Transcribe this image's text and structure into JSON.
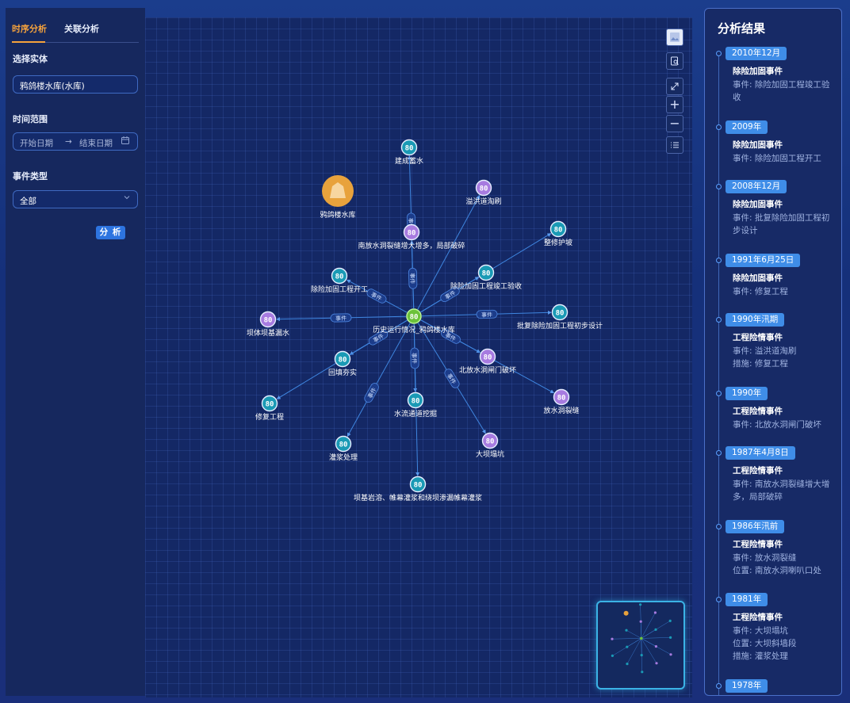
{
  "tabs": [
    {
      "label": "时序分析",
      "active": true
    },
    {
      "label": "关联分析",
      "active": false
    }
  ],
  "form": {
    "entity_label": "选择实体",
    "entity_value": "鸦鸽楼水库(水库)",
    "time_label": "时间范围",
    "start_placeholder": "开始日期",
    "end_placeholder": "结束日期",
    "event_type_label": "事件类型",
    "event_type_value": "全部",
    "analyze_button": "分 析"
  },
  "graph": {
    "edge_label": "事件",
    "center": {
      "label": "历史运行情况_鸦鸽楼水库",
      "icon": "80"
    },
    "reservoir": {
      "label": "鸦鸽楼水库"
    },
    "nodes": [
      {
        "label": "建成蓄水",
        "icon": "80",
        "color": "teal"
      },
      {
        "label": "溢洪道淘刷",
        "icon": "80",
        "color": "purple"
      },
      {
        "label": "南放水洞裂缝增大增多，局部破碎",
        "icon": "80",
        "color": "purple"
      },
      {
        "label": "整修护坡",
        "icon": "80",
        "color": "teal"
      },
      {
        "label": "除险加固工程开工",
        "icon": "80",
        "color": "teal"
      },
      {
        "label": "除险加固工程竣工验收",
        "icon": "80",
        "color": "teal"
      },
      {
        "label": "坝体坝基漏水",
        "icon": "80",
        "color": "purple"
      },
      {
        "label": "批复除险加固工程初步设计",
        "icon": "80",
        "color": "teal"
      },
      {
        "label": "回填夯实",
        "icon": "80",
        "color": "teal"
      },
      {
        "label": "北放水洞闸门破坏",
        "icon": "80",
        "color": "purple"
      },
      {
        "label": "修复工程",
        "icon": "80",
        "color": "teal"
      },
      {
        "label": "水流通道挖掘",
        "icon": "80",
        "color": "teal"
      },
      {
        "label": "放水洞裂缝",
        "icon": "80",
        "color": "purple"
      },
      {
        "label": "灌浆处理",
        "icon": "80",
        "color": "teal"
      },
      {
        "label": "大坝塌坑",
        "icon": "80",
        "color": "purple"
      },
      {
        "label": "坝基岩溶、帷幕灌浆和绕坝渗漏帷幕灌浆",
        "icon": "80",
        "color": "teal"
      }
    ]
  },
  "toolbar": [
    "image-icon",
    "search-doc-icon",
    "fullscreen-icon",
    "zoom-in-icon",
    "zoom-out-icon",
    "list-icon"
  ],
  "results": {
    "title": "分析结果",
    "entries": [
      {
        "date": "2010年12月",
        "title": "除险加固事件",
        "lines": [
          "事件: 除险加固工程竣工验收"
        ]
      },
      {
        "date": "2009年",
        "title": "除险加固事件",
        "lines": [
          "事件: 除险加固工程开工"
        ]
      },
      {
        "date": "2008年12月",
        "title": "除险加固事件",
        "lines": [
          "事件: 批复除险加固工程初步设计"
        ]
      },
      {
        "date": "1991年6月25日",
        "title": "除险加固事件",
        "lines": [
          "事件: 修复工程"
        ]
      },
      {
        "date": "1990年汛期",
        "title": "工程险情事件",
        "lines": [
          "事件: 溢洪道淘刷",
          "措施: 修复工程"
        ]
      },
      {
        "date": "1990年",
        "title": "工程险情事件",
        "lines": [
          "事件: 北放水洞闸门破坏"
        ]
      },
      {
        "date": "1987年4月8日",
        "title": "工程险情事件",
        "lines": [
          "事件: 南放水洞裂缝增大增多，局部破碎"
        ]
      },
      {
        "date": "1986年汛前",
        "title": "工程险情事件",
        "lines": [
          "事件: 放水洞裂缝",
          "位置: 南放水洞喇叭口处"
        ]
      },
      {
        "date": "1981年",
        "title": "工程险情事件",
        "lines": [
          "事件: 大坝塌坑",
          "位置: 大坝斜墙段",
          "措施: 灌浆处理"
        ]
      },
      {
        "date": "1978年",
        "title": "",
        "lines": []
      }
    ]
  },
  "colors": {
    "teal": "#1a9ab5",
    "purple": "#a77be0",
    "center": "#6cc23a",
    "reservoir": "#e8a23c",
    "edge": "#3f86e0",
    "accent": "#f5a23c"
  }
}
